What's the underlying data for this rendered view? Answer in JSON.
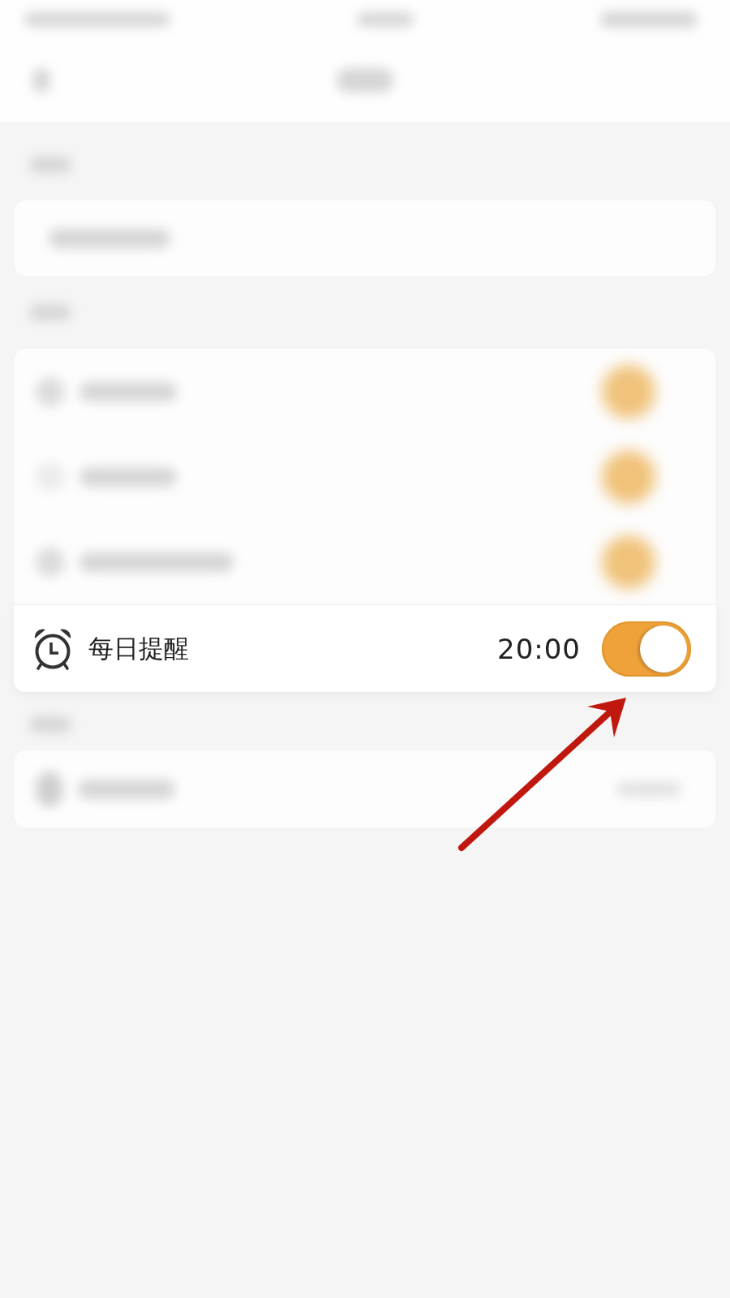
{
  "reminder_row": {
    "label": "每日提醒",
    "time": "20:00",
    "toggle": {
      "on": true
    }
  }
}
